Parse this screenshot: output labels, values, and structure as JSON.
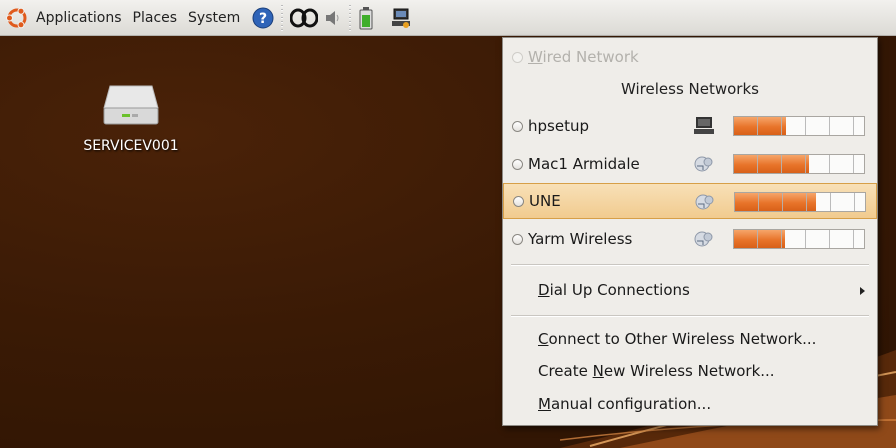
{
  "panel": {
    "menus": [
      "Applications",
      "Places",
      "System"
    ],
    "icons": [
      "ubuntu-logo-icon",
      "help-icon",
      "weather-icon",
      "volume-icon",
      "battery-icon",
      "network-manager-icon"
    ]
  },
  "desktop": {
    "icon_label": "SERVICEV001",
    "icon": "drive-icon"
  },
  "network_menu": {
    "wired": {
      "prefix": "",
      "mnemonic": "W",
      "rest": "ired Network"
    },
    "wireless_title": "Wireless Networks",
    "networks": [
      {
        "name": "hpsetup",
        "icon": "computer-icon",
        "strength": 40
      },
      {
        "name": "Mac1 Armidale",
        "icon": "network-icon",
        "strength": 58
      },
      {
        "name": "UNE",
        "icon": "network-icon",
        "strength": 62
      },
      {
        "name": "Yarm Wireless",
        "icon": "network-icon",
        "strength": 39
      }
    ],
    "dialup": {
      "prefix": "",
      "mnemonic": "D",
      "rest": "ial Up Connections"
    },
    "connect_other": {
      "prefix": "",
      "mnemonic": "C",
      "rest": "onnect to Other Wireless Network..."
    },
    "create_new": {
      "prefix": "Create ",
      "mnemonic": "N",
      "rest": "ew Wireless Network..."
    },
    "manual": {
      "prefix": "",
      "mnemonic": "M",
      "rest": "anual configuration..."
    }
  },
  "colors": {
    "desktop": "#3a1a05",
    "highlight": "#f1cb8f",
    "signal": "#e8742a"
  }
}
